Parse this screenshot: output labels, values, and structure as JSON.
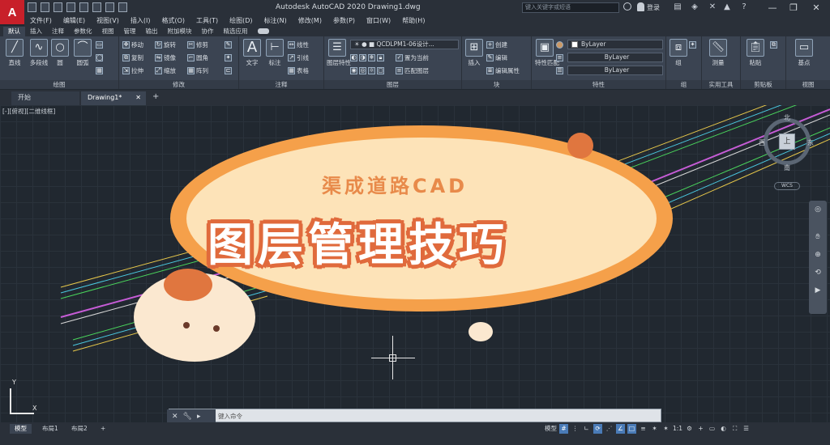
{
  "app": {
    "logo_letter": "A",
    "title": "Autodesk AutoCAD 2020    Drawing1.dwg",
    "search_placeholder": "键入关键字或短语",
    "login_label": "登录"
  },
  "menu": [
    "文件(F)",
    "编辑(E)",
    "视图(V)",
    "插入(I)",
    "格式(O)",
    "工具(T)",
    "绘图(D)",
    "标注(N)",
    "修改(M)",
    "参数(P)",
    "窗口(W)",
    "帮助(H)"
  ],
  "ribbon_tabs": [
    "默认",
    "插入",
    "注释",
    "参数化",
    "视图",
    "管理",
    "输出",
    "附加模块",
    "协作",
    "精选应用"
  ],
  "ribbon": {
    "draw": {
      "title": "绘图",
      "line": "直线",
      "polyline": "多段线",
      "circle": "圆",
      "arc": "圆弧"
    },
    "modify": {
      "title": "修改",
      "move": "移动",
      "rotate": "旋转",
      "trim": "修剪",
      "copy": "复制",
      "mirror": "镜像",
      "fillet": "圆角",
      "stretch": "拉伸",
      "scale": "缩放",
      "array": "阵列"
    },
    "annotation": {
      "title": "注释",
      "text": "文字",
      "dimension": "标注",
      "linear": "线性",
      "leader": "引线",
      "table": "表格"
    },
    "layers": {
      "title": "图层",
      "layer_properties": "图层特性",
      "current_layer": "QCDLPM1-06设计...",
      "make_current": "置为当前",
      "match_layer": "匹配图层"
    },
    "block": {
      "title": "块",
      "insert": "插入",
      "create": "创建",
      "edit": "编辑",
      "edit_attributes": "编辑属性"
    },
    "properties": {
      "title": "特性",
      "match": "特性匹配",
      "color": "ByLayer",
      "linetype": "ByLayer",
      "lineweight": "ByLayer"
    },
    "groups": {
      "title": "组",
      "group": "组"
    },
    "utilities": {
      "title": "实用工具",
      "measure": "测量"
    },
    "clipboard": {
      "title": "剪贴板",
      "paste": "粘贴"
    },
    "view": {
      "title": "视图",
      "base": "基点"
    }
  },
  "file_tabs": {
    "start": "开始",
    "drawing": "Drawing1*",
    "close": "✕",
    "add": "+"
  },
  "viewport": {
    "label": "[-][俯视][二维线框]"
  },
  "viewcube": {
    "face": "上",
    "north": "北",
    "south": "南",
    "east": "东",
    "west": "西",
    "wcs": "WCS"
  },
  "ucs": {
    "x": "X",
    "y": "Y"
  },
  "command": {
    "placeholder": "键入命令"
  },
  "layout_tabs": [
    "模型",
    "布局1",
    "布局2",
    "+"
  ],
  "status": {
    "model": "模型",
    "scale": "1:1"
  },
  "card": {
    "subtitle": "渠成道路CAD",
    "title": "图层管理技巧"
  },
  "colors": {
    "accent_orange": "#f5a04a",
    "card_fill": "#fde3b8",
    "road_magenta": "#c65cd6",
    "road_yellow": "#e8c84a",
    "road_cyan": "#4ac8e0",
    "road_green": "#4ad65c"
  }
}
